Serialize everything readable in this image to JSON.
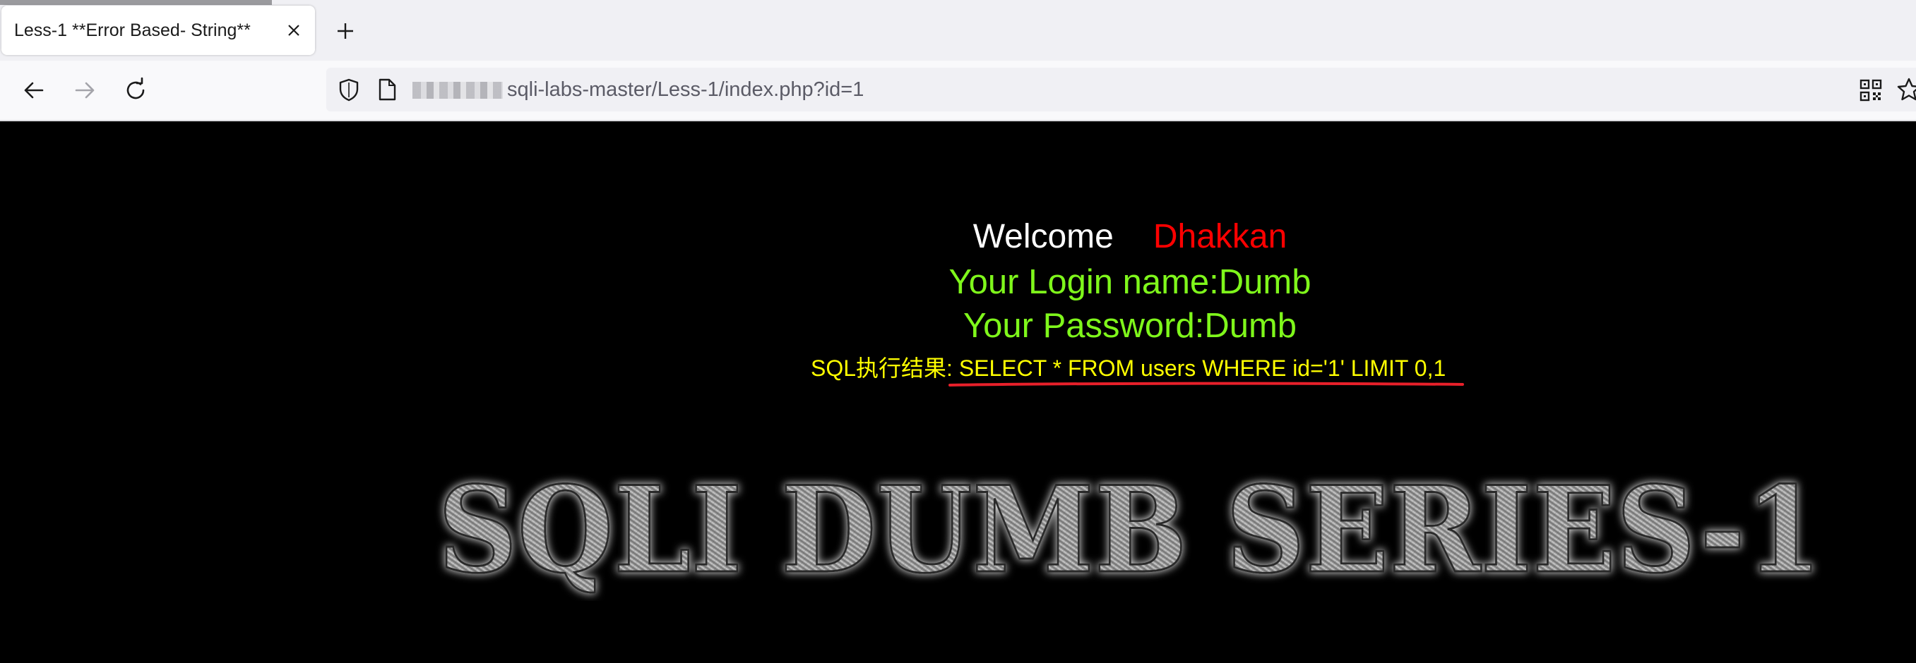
{
  "browser": {
    "tab_title": "Less-1 **Error Based- String**",
    "url_path": "sqli-labs-master/Less-1/index.php?id=1"
  },
  "page": {
    "welcome_label": "Welcome",
    "welcome_name": "Dhakkan",
    "login_line": "Your Login name:Dumb",
    "password_line": "Your Password:Dumb",
    "sql_line": "SQL执行结果: SELECT * FROM users WHERE id='1' LIMIT 0,1",
    "banner": "SQLI DUMB SERIES-1"
  },
  "colors": {
    "background": "#000000",
    "welcome": "#ffffff",
    "name": "#ff0000",
    "login_text": "#7ff71b",
    "sql_text": "#ffff00",
    "annotation_underline": "#e8202a"
  },
  "icons": [
    "tab-close-icon",
    "new-tab-icon",
    "back-arrow-icon",
    "forward-arrow-icon",
    "reload-icon",
    "shield-icon",
    "page-icon",
    "qr-code-icon",
    "bookmark-star-icon"
  ]
}
